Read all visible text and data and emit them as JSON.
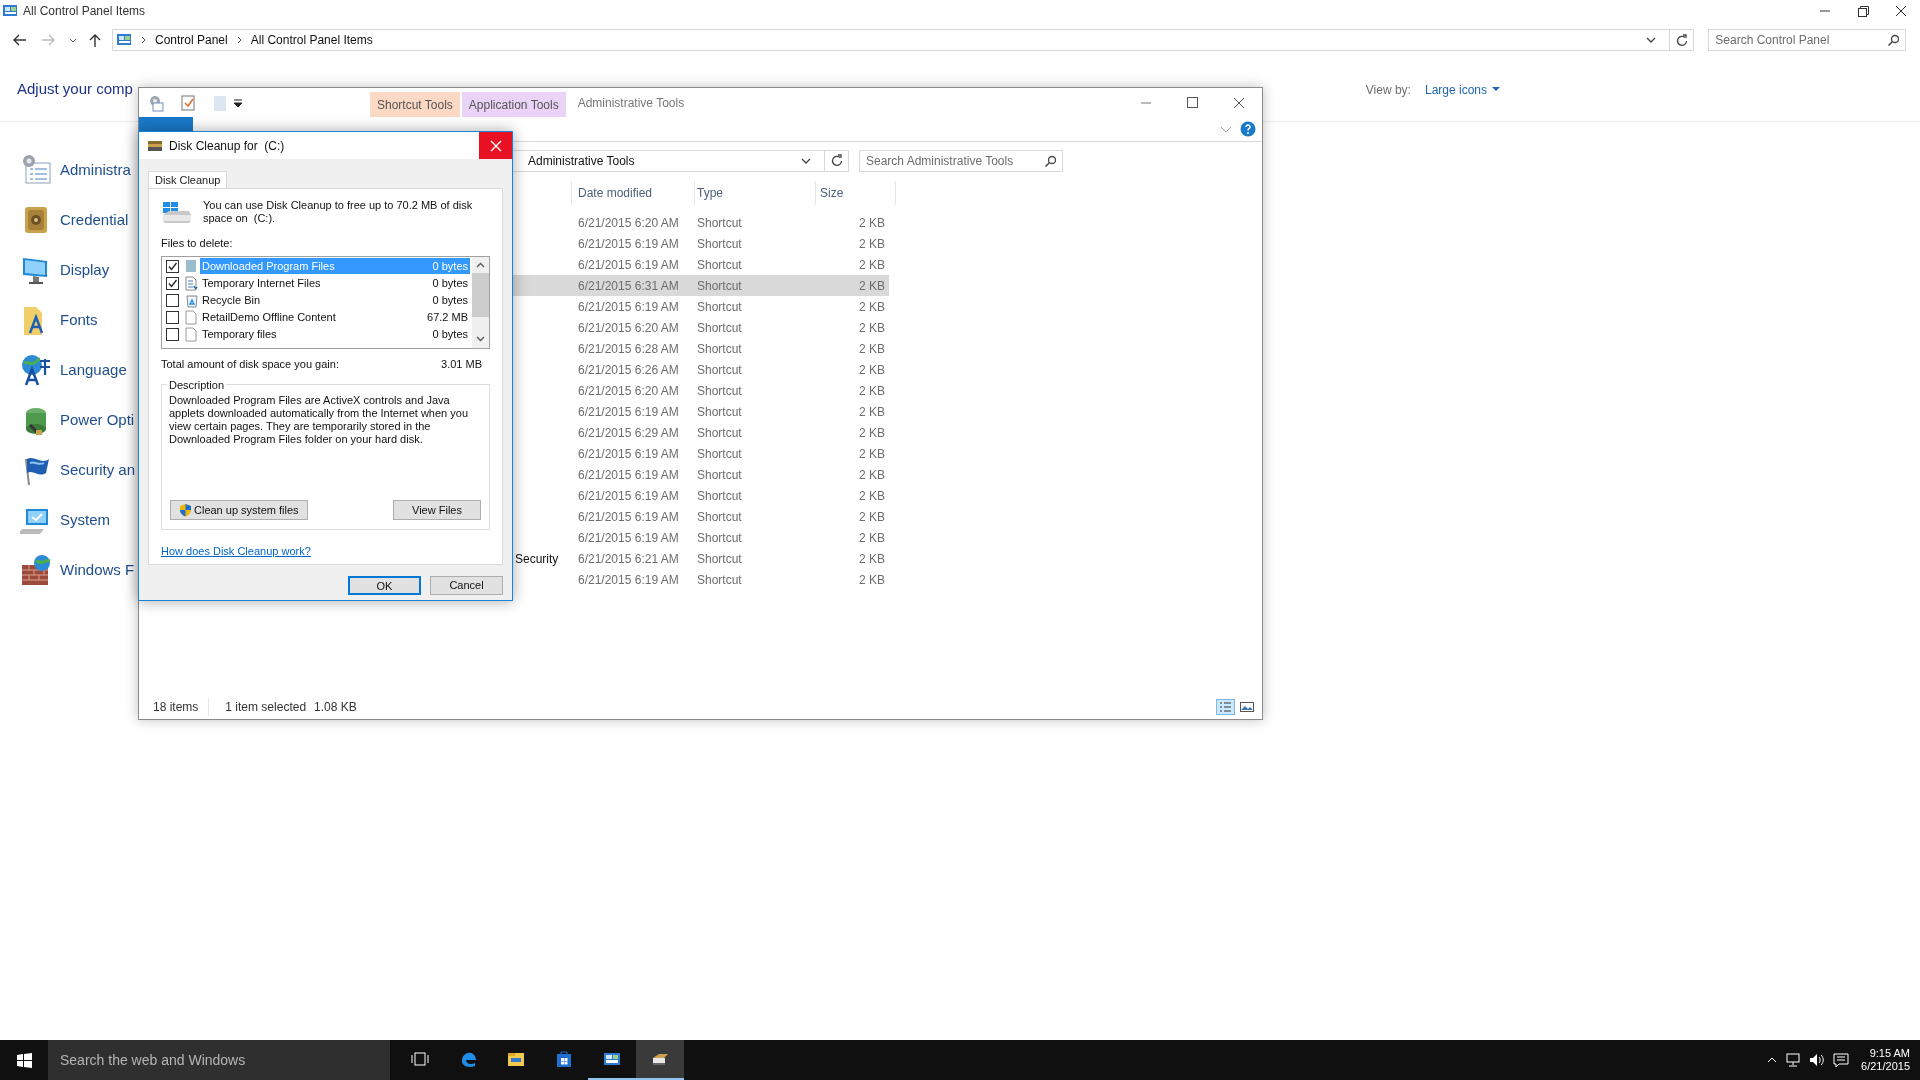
{
  "control_panel": {
    "title": "All Control Panel Items",
    "breadcrumb": [
      "Control Panel",
      "All Control Panel Items"
    ],
    "search": {
      "placeholder": "Search Control Panel"
    },
    "heading": "Adjust your comp",
    "view_by": {
      "label": "View by:",
      "value": "Large icons"
    },
    "items": [
      {
        "label": "Administra",
        "kind": "tools"
      },
      {
        "label": "Credential",
        "kind": "vault"
      },
      {
        "label": "Display",
        "kind": "monitor"
      },
      {
        "label": "Fonts",
        "kind": "fonts"
      },
      {
        "label": "Language",
        "kind": "language"
      },
      {
        "label": "Power Opti",
        "kind": "power"
      },
      {
        "label": "Security an",
        "kind": "flag"
      },
      {
        "label": "System",
        "kind": "system"
      },
      {
        "label": "Windows F",
        "kind": "firewall"
      }
    ]
  },
  "explorer": {
    "title": "Administrative Tools",
    "context_tabs": [
      {
        "label": "Shortcut Tools",
        "color": "#fcd9c4"
      },
      {
        "label": "Application Tools",
        "color": "#ebd3f7"
      }
    ],
    "ribbon_tabs": [
      {
        "kind": "file"
      }
    ],
    "address": "Administrative Tools",
    "search": {
      "placeholder": "Search Administrative Tools"
    },
    "columns": [
      "Date modified",
      "Type",
      "Size"
    ],
    "rows": [
      {
        "date": "6/21/2015 6:20 AM",
        "type": "Shortcut",
        "size": "2 KB",
        "selected": false
      },
      {
        "date": "6/21/2015 6:19 AM",
        "type": "Shortcut",
        "size": "2 KB",
        "selected": false
      },
      {
        "date": "6/21/2015 6:19 AM",
        "type": "Shortcut",
        "size": "2 KB",
        "selected": false
      },
      {
        "date": "6/21/2015 6:31 AM",
        "type": "Shortcut",
        "size": "2 KB",
        "selected": true
      },
      {
        "date": "6/21/2015 6:19 AM",
        "type": "Shortcut",
        "size": "2 KB",
        "selected": false
      },
      {
        "date": "6/21/2015 6:20 AM",
        "type": "Shortcut",
        "size": "2 KB",
        "selected": false
      },
      {
        "date": "6/21/2015 6:28 AM",
        "type": "Shortcut",
        "size": "2 KB",
        "selected": false
      },
      {
        "date": "6/21/2015 6:26 AM",
        "type": "Shortcut",
        "size": "2 KB",
        "selected": false
      },
      {
        "date": "6/21/2015 6:20 AM",
        "type": "Shortcut",
        "size": "2 KB",
        "selected": false
      },
      {
        "date": "6/21/2015 6:19 AM",
        "type": "Shortcut",
        "size": "2 KB",
        "selected": false
      },
      {
        "date": "6/21/2015 6:29 AM",
        "type": "Shortcut",
        "size": "2 KB",
        "selected": false
      },
      {
        "date": "6/21/2015 6:19 AM",
        "type": "Shortcut",
        "size": "2 KB",
        "selected": false
      },
      {
        "date": "6/21/2015 6:19 AM",
        "type": "Shortcut",
        "size": "2 KB",
        "selected": false
      },
      {
        "date": "6/21/2015 6:19 AM",
        "type": "Shortcut",
        "size": "2 KB",
        "selected": false
      },
      {
        "date": "6/21/2015 6:19 AM",
        "type": "Shortcut",
        "size": "2 KB",
        "selected": false
      },
      {
        "date": "6/21/2015 6:19 AM",
        "type": "Shortcut",
        "size": "2 KB",
        "selected": false
      },
      {
        "name": "Security",
        "date": "6/21/2015 6:21 AM",
        "type": "Shortcut",
        "size": "2 KB",
        "selected": false
      },
      {
        "date": "6/21/2015 6:19 AM",
        "type": "Shortcut",
        "size": "2 KB",
        "selected": false
      }
    ],
    "status_bar": {
      "item_count": "18 items",
      "selection": "1 item selected",
      "selection_size": "1.08 KB"
    }
  },
  "dialog": {
    "title": "Disk Cleanup for  (C:)",
    "tab": "Disk Cleanup",
    "intro": "You can use Disk Cleanup to free up to 70.2 MB of disk space on  (C:).",
    "files_label": "Files to delete:",
    "files": [
      {
        "label": "Downloaded Program Files",
        "size": "0 bytes",
        "checked": true,
        "selected": true,
        "kind": "folder"
      },
      {
        "label": "Temporary Internet Files",
        "size": "0 bytes",
        "checked": true,
        "selected": false,
        "kind": "document"
      },
      {
        "label": "Recycle Bin",
        "size": "0 bytes",
        "checked": false,
        "selected": false,
        "kind": "recycle"
      },
      {
        "label": "RetailDemo Offline Content",
        "size": "67.2 MB",
        "checked": false,
        "selected": false,
        "kind": "page"
      },
      {
        "label": "Temporary files",
        "size": "0 bytes",
        "checked": false,
        "selected": false,
        "kind": "page"
      }
    ],
    "total_label": "Total amount of disk space you gain:",
    "total_value": "3.01 MB",
    "description_title": "Description",
    "description": "Downloaded Program Files are ActiveX controls and Java applets downloaded automatically from the Internet when you view certain pages. They are temporarily stored in the Downloaded Program Files folder on your hard disk.",
    "cleanup_button": "Clean up system files",
    "view_button": "View Files",
    "help_link": "How does Disk Cleanup work?",
    "ok_button": "OK",
    "cancel_button": "Cancel"
  },
  "taskbar": {
    "search": {
      "placeholder": "Search the web and Windows"
    },
    "apps": [
      {
        "kind": "taskview",
        "running": false,
        "selected": false
      },
      {
        "kind": "edge",
        "running": false,
        "selected": false
      },
      {
        "kind": "explorer",
        "running": false,
        "selected": false
      },
      {
        "kind": "store",
        "running": false,
        "selected": false
      },
      {
        "kind": "control",
        "running": true,
        "selected": false
      },
      {
        "kind": "cleanup",
        "running": true,
        "selected": true
      }
    ],
    "time": "9:15 AM",
    "date": "6/21/2015"
  }
}
